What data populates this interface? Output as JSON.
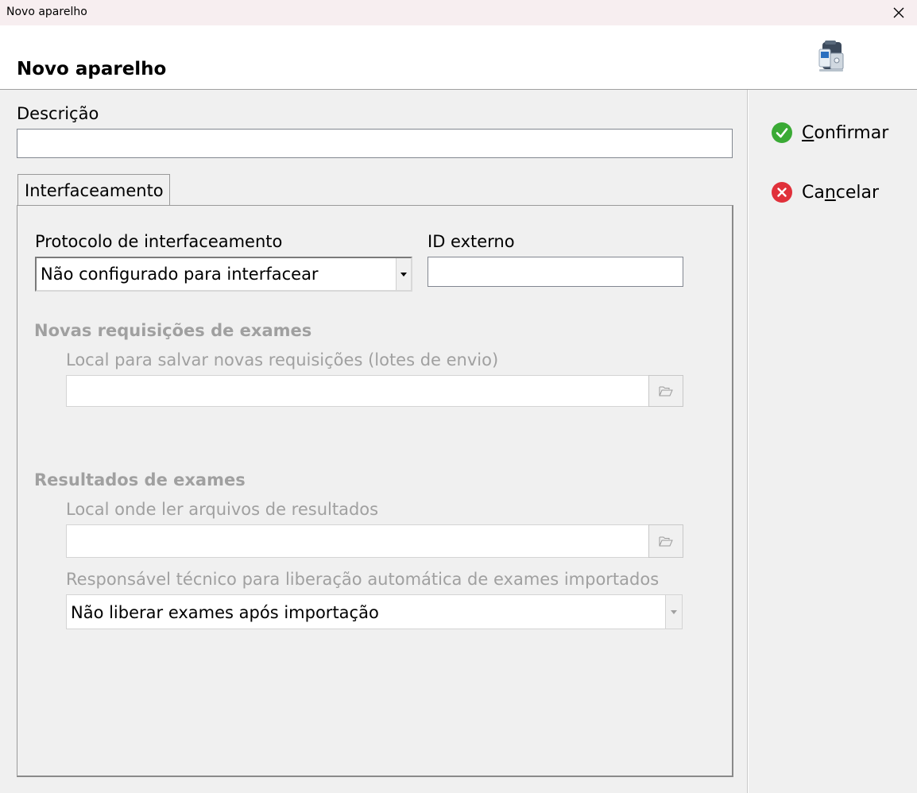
{
  "window": {
    "title": "Novo aparelho"
  },
  "header": {
    "title": "Novo aparelho"
  },
  "form": {
    "description_label": "Descrição",
    "description_value": "",
    "tab_label": "Interfaceamento",
    "protocol_label": "Protocolo de interfaceamento",
    "protocol_value": "Não configurado para interfacear",
    "external_id_label": "ID externo",
    "external_id_value": "",
    "requests_section": "Novas requisições de exames",
    "requests_path_label": "Local para salvar novas requisições (lotes de envio)",
    "requests_path_value": "",
    "results_section": "Resultados de exames",
    "results_path_label": "Local onde ler arquivos de resultados",
    "results_path_value": "",
    "responsible_label": "Responsável técnico para liberação automática de exames importados",
    "responsible_value": "Não liberar exames após importação"
  },
  "actions": {
    "confirm": {
      "pre": "",
      "mnemonic": "C",
      "post": "onfirmar"
    },
    "cancel": {
      "pre": "Ca",
      "mnemonic": "n",
      "post": "celar"
    }
  },
  "colors": {
    "confirm": "#3aaa35",
    "cancel": "#e0303a",
    "disabled_text": "#a0a0a0"
  },
  "icons": [
    "close-icon",
    "device-icon",
    "dropdown-arrow-icon",
    "folder-open-icon",
    "check-circle-icon",
    "cancel-circle-icon"
  ]
}
